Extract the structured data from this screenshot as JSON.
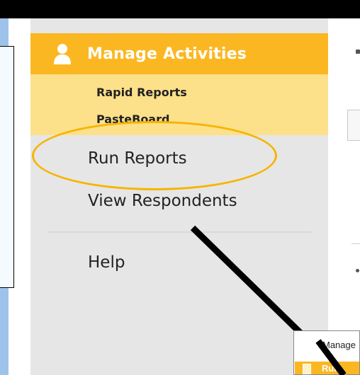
{
  "manage_activities": {
    "title": "Manage Activities",
    "icon": "user-icon",
    "accent_color": "#fbb722",
    "submenu_color": "#fde08a",
    "submenu": [
      {
        "label": "Rapid Reports"
      },
      {
        "label": "PasteBoard"
      }
    ]
  },
  "nav": {
    "run_reports": "Run Reports",
    "view_respondents": "View Respondents",
    "help": "Help"
  },
  "highlight": {
    "color": "#f7b400",
    "target": "Run Reports"
  },
  "inset": {
    "manage_label": "Manage",
    "run_label": "Run"
  }
}
